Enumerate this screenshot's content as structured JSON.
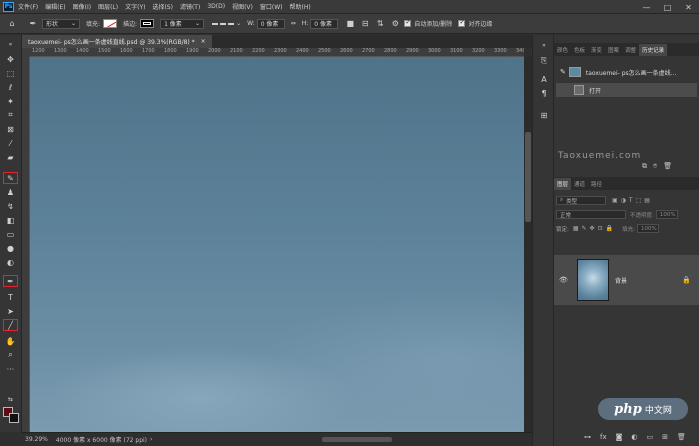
{
  "menubar": {
    "logo": "Ps",
    "items": [
      "文件(F)",
      "编辑(E)",
      "图像(I)",
      "图层(L)",
      "文字(Y)",
      "选择(S)",
      "滤镜(T)",
      "3D(D)",
      "视图(V)",
      "窗口(W)",
      "帮助(H)"
    ],
    "window_controls": {
      "minimize": "—",
      "maximize": "□",
      "close": "✕"
    }
  },
  "options": {
    "mode": "形状",
    "fill_label": "填充:",
    "stroke_label": "描边:",
    "stroke_width": "1 像素",
    "w_label": "W:",
    "w_value": "0 像素",
    "link": "⇔",
    "h_label": "H:",
    "h_value": "0 像素",
    "auto_add_delete": "自动添加/删除",
    "align_edges": "对齐边缘"
  },
  "document": {
    "tab_title": "taoxuemei- ps怎么画一条虚线直线.psd @ 39.3%(RGB/8) *",
    "close": "×"
  },
  "ruler": {
    "labels": [
      "1200",
      "1300",
      "1400",
      "1500",
      "1600",
      "1700",
      "1800",
      "1900",
      "2000",
      "2100",
      "2200",
      "2300",
      "2400",
      "2500",
      "2600",
      "2700",
      "2800",
      "2900",
      "3000",
      "3100",
      "3200",
      "3300",
      "3400"
    ]
  },
  "status": {
    "zoom": "39.29%",
    "doc_size": "4000 像素 x 6000 像素 (72 ppi)",
    "arrow": "›"
  },
  "history_panel": {
    "tabs": [
      "颜色",
      "色板",
      "渐变",
      "图案",
      "调整",
      "历史记录"
    ],
    "active_tab": "历史记录",
    "snapshot": "taoxuemei- ps怎么画一条虚线...",
    "steps": [
      "打开"
    ]
  },
  "watermark_text": "Taoxuemei.com",
  "layers_panel": {
    "tabs": [
      "图层",
      "通道",
      "路径"
    ],
    "active_tab": "图层",
    "search_kind": "类型",
    "blend_mode": "正常",
    "opacity_label": "不透明度:",
    "opacity_value": "100%",
    "lock_label": "锁定:",
    "fill_label": "填充:",
    "fill_value": "100%",
    "layer_name": "背景"
  },
  "php_badge": {
    "logo": "php",
    "text": "中文网"
  },
  "colors": {
    "foreground": "#5a0e14",
    "background": "#111111",
    "highlight": "#e0262c",
    "canvas": "#5c8299"
  }
}
